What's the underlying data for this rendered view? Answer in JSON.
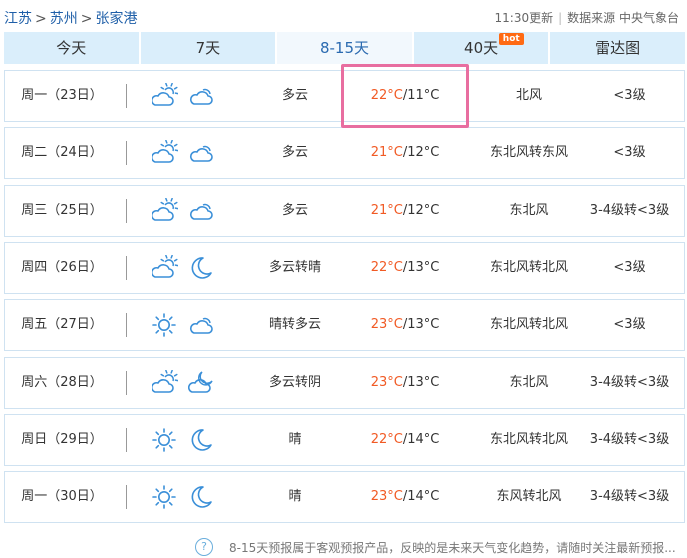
{
  "breadcrumb": {
    "province": "江苏",
    "city": "苏州",
    "county": "张家港",
    "sep": ">"
  },
  "meta": {
    "updated": "11:30更新",
    "divider": "|",
    "source": "数据来源 中央气象台"
  },
  "tabs": [
    {
      "label": "今天"
    },
    {
      "label": "7天"
    },
    {
      "label": "8-15天"
    },
    {
      "label": "40天",
      "badge": "hot"
    },
    {
      "label": "雷达图"
    }
  ],
  "forecast": [
    {
      "date": "周一（23日）",
      "icons": [
        "partly-cloudy-icon",
        "cloudy-icon"
      ],
      "desc": "多云",
      "hi": "22°C",
      "lo": "/11°C",
      "wind": "北风",
      "level": "<3级"
    },
    {
      "date": "周二（24日）",
      "icons": [
        "partly-cloudy-icon",
        "cloudy-icon"
      ],
      "desc": "多云",
      "hi": "21°C",
      "lo": "/12°C",
      "wind": "东北风转东风",
      "level": "<3级"
    },
    {
      "date": "周三（25日）",
      "icons": [
        "partly-cloudy-icon",
        "cloudy-icon"
      ],
      "desc": "多云",
      "hi": "21°C",
      "lo": "/12°C",
      "wind": "东北风",
      "level": "3-4级转<3级"
    },
    {
      "date": "周四（26日）",
      "icons": [
        "partly-cloudy-icon",
        "moon-icon"
      ],
      "desc": "多云转晴",
      "hi": "22°C",
      "lo": "/13°C",
      "wind": "东北风转北风",
      "level": "<3级"
    },
    {
      "date": "周五（27日）",
      "icons": [
        "sun-icon",
        "cloudy-icon"
      ],
      "desc": "晴转多云",
      "hi": "23°C",
      "lo": "/13°C",
      "wind": "东北风转北风",
      "level": "<3级"
    },
    {
      "date": "周六（28日）",
      "icons": [
        "partly-cloudy-icon",
        "cloudy-night-icon"
      ],
      "desc": "多云转阴",
      "hi": "23°C",
      "lo": "/13°C",
      "wind": "东北风",
      "level": "3-4级转<3级"
    },
    {
      "date": "周日（29日）",
      "icons": [
        "sun-icon",
        "moon-icon"
      ],
      "desc": "晴",
      "hi": "22°C",
      "lo": "/14°C",
      "wind": "东北风转北风",
      "level": "3-4级转<3级"
    },
    {
      "date": "周一（30日）",
      "icons": [
        "sun-icon",
        "moon-icon"
      ],
      "desc": "晴",
      "hi": "23°C",
      "lo": "/14°C",
      "wind": "东风转北风",
      "level": "3-4级转<3级"
    }
  ],
  "footer": {
    "help_icon": "?",
    "note": "8-15天预报属于客观预报产品，反映的是未来天气变化趋势，请随时关注最新预报..."
  },
  "colors": {
    "tab_bg": "#daeefb",
    "accent_blue": "#2a6ab0",
    "high_temp": "#f15a24",
    "highlight": "#e86ea0",
    "icon": "#3a8fd8"
  }
}
